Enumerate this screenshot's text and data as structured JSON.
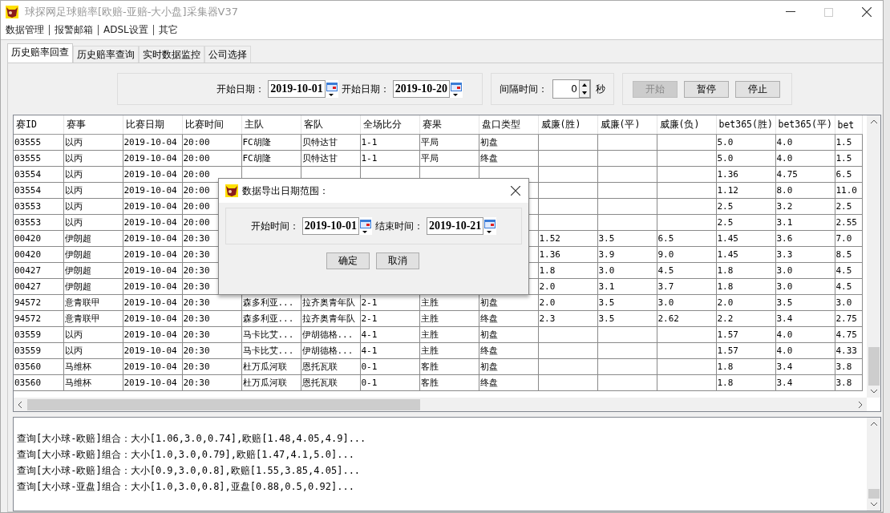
{
  "window": {
    "title": "球探网足球赔率[欧赔-亚赔-大小盘]采集器V37"
  },
  "menu": [
    {
      "label": "数据管理"
    },
    {
      "label": "报警邮箱"
    },
    {
      "label": "ADSL设置"
    },
    {
      "label": "其它"
    }
  ],
  "tabs": [
    {
      "label": "历史赔率回查",
      "selected": true
    },
    {
      "label": "历史赔率查询",
      "selected": false
    },
    {
      "label": "实时数据监控",
      "selected": false
    },
    {
      "label": "公司选择",
      "selected": false
    }
  ],
  "query": {
    "start_label": "开始日期：",
    "start_date": "2019-10-01",
    "end_label": "开始日期：",
    "end_date": "2019-10-20"
  },
  "interval": {
    "label": "间隔时间：",
    "value": "0",
    "unit": "秒"
  },
  "buttons": [
    {
      "label": "开始",
      "disabled": true
    },
    {
      "label": "暂停",
      "disabled": false
    },
    {
      "label": "停止",
      "disabled": false
    }
  ],
  "table": {
    "columns": [
      "赛ID",
      "赛事",
      "比赛日期",
      "比赛时间",
      "主队",
      "客队",
      "全场比分",
      "赛果",
      "盘口类型",
      "威廉(胜)",
      "威廉(平)",
      "威廉(负)",
      "bet365(胜)",
      "bet365(平)",
      "bet"
    ],
    "rows": [
      [
        "03555",
        "以丙",
        "2019-10-04",
        "20:00",
        "FC胡隆",
        "贝特达甘",
        "1-1",
        "平局",
        "初盘",
        null,
        null,
        null,
        "5.0",
        "4.0",
        "1.5"
      ],
      [
        "03555",
        "以丙",
        "2019-10-04",
        "20:00",
        "FC胡隆",
        "贝特达甘",
        "1-1",
        "平局",
        "终盘",
        null,
        null,
        null,
        "5.0",
        "4.0",
        "1.5"
      ],
      [
        "03554",
        "以丙",
        "2019-10-04",
        "20:00",
        null,
        null,
        null,
        null,
        null,
        null,
        null,
        null,
        "1.36",
        "4.75",
        "6.5"
      ],
      [
        "03554",
        "以丙",
        "2019-10-04",
        "20:00",
        null,
        null,
        null,
        null,
        null,
        null,
        null,
        null,
        "1.12",
        "8.0",
        "11.0"
      ],
      [
        "03553",
        "以丙",
        "2019-10-04",
        "20:00",
        null,
        null,
        null,
        null,
        null,
        null,
        null,
        null,
        "2.5",
        "3.2",
        "2.5"
      ],
      [
        "03553",
        "以丙",
        "2019-10-04",
        "20:00",
        null,
        null,
        null,
        null,
        null,
        null,
        null,
        null,
        "2.5",
        "3.1",
        "2.55"
      ],
      [
        "00420",
        "伊朗超",
        "2019-10-04",
        "20:30",
        null,
        null,
        null,
        null,
        null,
        "1.52",
        "3.5",
        "6.5",
        "1.45",
        "3.6",
        "7.0"
      ],
      [
        "00420",
        "伊朗超",
        "2019-10-04",
        "20:30",
        null,
        null,
        null,
        null,
        null,
        "1.36",
        "3.9",
        "9.0",
        "1.45",
        "3.3",
        "8.5"
      ],
      [
        "00427",
        "伊朗超",
        "2019-10-04",
        "20:30",
        null,
        null,
        null,
        null,
        null,
        "1.8",
        "3.0",
        "4.5",
        "1.8",
        "3.0",
        "4.5"
      ],
      [
        "00427",
        "伊朗超",
        "2019-10-04",
        "20:30",
        null,
        null,
        null,
        null,
        null,
        "2.0",
        "3.1",
        "3.7",
        "1.8",
        "3.0",
        "4.5"
      ],
      [
        "94572",
        "意青联甲",
        "2019-10-04",
        "20:30",
        "森多利亚...",
        "拉齐奥青年队",
        "2-1",
        "主胜",
        "初盘",
        "2.0",
        "3.5",
        "3.0",
        "2.0",
        "3.5",
        "3.0"
      ],
      [
        "94572",
        "意青联甲",
        "2019-10-04",
        "20:30",
        "森多利亚...",
        "拉齐奥青年队",
        "2-1",
        "主胜",
        "终盘",
        "2.3",
        "3.5",
        "2.62",
        "2.2",
        "3.4",
        "2.75"
      ],
      [
        "03559",
        "以丙",
        "2019-10-04",
        "20:30",
        "马卡比艾...",
        "伊胡德格...",
        "4-1",
        "主胜",
        "初盘",
        null,
        null,
        null,
        "1.57",
        "4.0",
        "4.75"
      ],
      [
        "03559",
        "以丙",
        "2019-10-04",
        "20:30",
        "马卡比艾...",
        "伊胡德格...",
        "4-1",
        "主胜",
        "终盘",
        null,
        null,
        null,
        "1.57",
        "4.0",
        "4.33"
      ],
      [
        "03560",
        "马维杯",
        "2019-10-04",
        "20:30",
        "杜万瓜河联",
        "恩托瓦联",
        "0-1",
        "客胜",
        "初盘",
        null,
        null,
        null,
        "1.8",
        "3.4",
        "3.8"
      ],
      [
        "03560",
        "马维杯",
        "2019-10-04",
        "20:30",
        "杜万瓜河联",
        "恩托瓦联",
        "0-1",
        "客胜",
        "终盘",
        null,
        null,
        null,
        "1.8",
        "3.4",
        "3.8"
      ]
    ]
  },
  "log": {
    "lines": [
      "查询[大小球-欧赔]组合：大小[1.06,3.0,0.74],欧赔[1.48,4.05,4.9]...",
      "查询[大小球-欧赔]组合：大小[1.0,3.0,0.79],欧赔[1.47,4.1,5.0]...",
      "查询[大小球-欧赔]组合：大小[0.9,3.0,0.8],欧赔[1.55,3.85,4.05]...",
      "查询[大小球-亚盘]组合：大小[1.0,3.0,0.8],亚盘[0.88,0.5,0.92]..."
    ]
  },
  "dialog": {
    "title": "数据导出日期范围：",
    "start_label": "开始时间：",
    "start_date": "2019-10-01",
    "end_label": "结束时间：",
    "end_date": "2019-10-21",
    "buttons": [
      "确定",
      "取消"
    ]
  }
}
